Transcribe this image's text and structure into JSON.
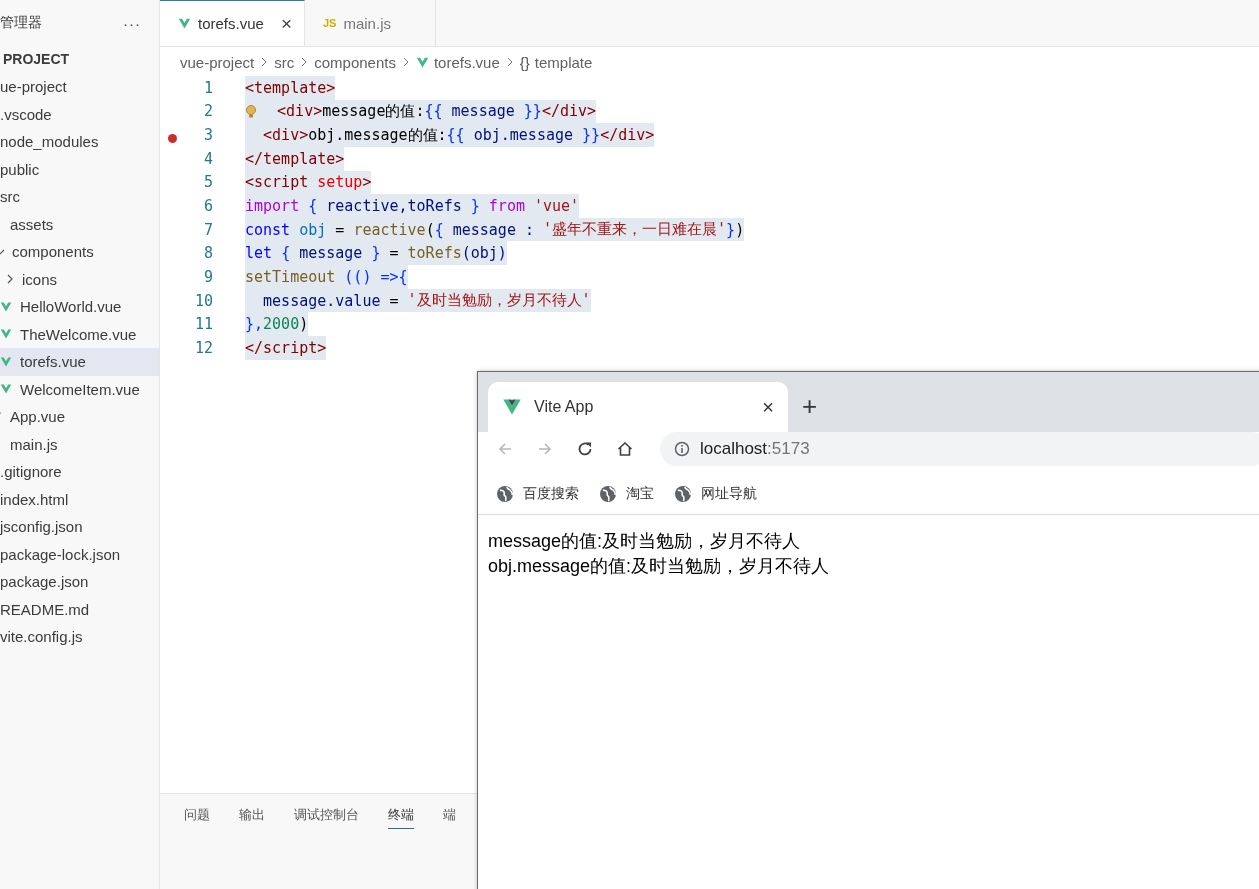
{
  "sidebar": {
    "title": "管理器",
    "more": "···",
    "section": "PROJECT",
    "root": "ue-project",
    "tree": [
      {
        "label": ".vscode",
        "selected": false
      },
      {
        "label": "node_modules",
        "selected": false
      },
      {
        "label": "public",
        "selected": false
      },
      {
        "label": "src",
        "selected": false,
        "children": [
          {
            "label": "assets",
            "selected": false
          },
          {
            "label": "components",
            "expanded": true,
            "selected": false,
            "children": [
              {
                "label": "icons",
                "expanded": false,
                "selected": false
              },
              {
                "label": "HelloWorld.vue",
                "kind": "vue",
                "selected": false
              },
              {
                "label": "TheWelcome.vue",
                "kind": "vue",
                "selected": false
              },
              {
                "label": "torefs.vue",
                "kind": "vue",
                "selected": true
              },
              {
                "label": "WelcomeItem.vue",
                "kind": "vue",
                "selected": false
              }
            ]
          },
          {
            "label": "App.vue",
            "kind": "vue",
            "selected": false
          },
          {
            "label": "main.js",
            "selected": false
          }
        ]
      },
      {
        "label": ".gitignore",
        "selected": false
      },
      {
        "label": "index.html",
        "selected": false
      },
      {
        "label": "jsconfig.json",
        "selected": false
      },
      {
        "label": "package-lock.json",
        "selected": false
      },
      {
        "label": "package.json",
        "selected": false
      },
      {
        "label": "README.md",
        "selected": false
      },
      {
        "label": "vite.config.js",
        "selected": false
      }
    ]
  },
  "tabs": [
    {
      "label": "torefs.vue",
      "kind": "vue",
      "selected": true,
      "close": "×"
    },
    {
      "label": "main.js",
      "kind": "js",
      "badge": "JS",
      "selected": false
    }
  ],
  "breadcrumb": [
    {
      "label": "vue-project"
    },
    {
      "label": "src"
    },
    {
      "label": "components"
    },
    {
      "label": "torefs.vue",
      "kind": "vue"
    },
    {
      "label": "template",
      "kind": "symbol",
      "badge": "{}"
    }
  ],
  "code": [
    {
      "number": "1",
      "selected": true,
      "tokens": [
        {
          "text": "<template>",
          "kind": "tag"
        }
      ]
    },
    {
      "number": "2",
      "selected": true,
      "lightbulb": true,
      "tokens": [
        {
          "text": "  <div>",
          "kind": "tag"
        },
        {
          "text": "message的值:",
          "kind": "plain"
        },
        {
          "text": "{{",
          "kind": "brace"
        },
        {
          "text": " message ",
          "kind": "prop"
        },
        {
          "text": "}}",
          "kind": "brace"
        },
        {
          "text": "</div>",
          "kind": "tag"
        }
      ]
    },
    {
      "number": "3",
      "selected": true,
      "breakpoint": true,
      "tokens": [
        {
          "text": "  <div>",
          "kind": "tag"
        },
        {
          "text": "obj.message的值:",
          "kind": "plain"
        },
        {
          "text": "{{",
          "kind": "brace"
        },
        {
          "text": " obj.message ",
          "kind": "prop"
        },
        {
          "text": "}}",
          "kind": "brace"
        },
        {
          "text": "</div>",
          "kind": "tag"
        }
      ]
    },
    {
      "number": "4",
      "selected": true,
      "tokens": [
        {
          "text": "</template>",
          "kind": "tag"
        }
      ]
    },
    {
      "number": "5",
      "selected": true,
      "tokens": [
        {
          "text": "<script ",
          "kind": "tag"
        },
        {
          "text": "setup",
          "kind": "attr"
        },
        {
          "text": ">",
          "kind": "tag"
        }
      ]
    },
    {
      "number": "6",
      "selected": true,
      "tokens": [
        {
          "text": "import ",
          "kind": "ctl"
        },
        {
          "text": "{",
          "kind": "brace"
        },
        {
          "text": " reactive,toRefs ",
          "kind": "prop"
        },
        {
          "text": "} ",
          "kind": "brace"
        },
        {
          "text": "from ",
          "kind": "ctl"
        },
        {
          "text": "'vue'",
          "kind": "str"
        }
      ]
    },
    {
      "number": "7",
      "selected": true,
      "tokens": [
        {
          "text": "const ",
          "kind": "kw"
        },
        {
          "text": "obj",
          "kind": "var"
        },
        {
          "text": " = ",
          "kind": "plain"
        },
        {
          "text": "reactive",
          "kind": "func"
        },
        {
          "text": "(",
          "kind": "plain"
        },
        {
          "text": "{",
          "kind": "brace"
        },
        {
          "text": " message : ",
          "kind": "prop"
        },
        {
          "text": "'盛年不重来，一日难在晨'",
          "kind": "str"
        },
        {
          "text": "}",
          "kind": "brace"
        },
        {
          "text": ")",
          "kind": "plain"
        }
      ]
    },
    {
      "number": "8",
      "selected": true,
      "tokens": [
        {
          "text": "let ",
          "kind": "kw"
        },
        {
          "text": "{",
          "kind": "brace"
        },
        {
          "text": " message ",
          "kind": "prop"
        },
        {
          "text": "}",
          "kind": "brace"
        },
        {
          "text": " = ",
          "kind": "plain"
        },
        {
          "text": "toRefs",
          "kind": "func"
        },
        {
          "text": "(obj)",
          "kind": "prop"
        }
      ]
    },
    {
      "number": "9",
      "selected": true,
      "tokens": [
        {
          "text": "setTimeout ",
          "kind": "func"
        },
        {
          "text": "(() =>{",
          "kind": "brace"
        }
      ]
    },
    {
      "number": "10",
      "selected": true,
      "tokens": [
        {
          "text": "  message.value",
          "kind": "prop"
        },
        {
          "text": " = ",
          "kind": "plain"
        },
        {
          "text": "'及时当勉励，岁月不待人'",
          "kind": "str"
        }
      ]
    },
    {
      "number": "11",
      "selected": true,
      "tokens": [
        {
          "text": "},",
          "kind": "brace"
        },
        {
          "text": "2000",
          "kind": "num"
        },
        {
          "text": ")",
          "kind": "plain"
        }
      ]
    },
    {
      "number": "12",
      "selected": true,
      "tokens": [
        {
          "text": "</script>",
          "kind": "tag"
        }
      ]
    }
  ],
  "panel": {
    "tabs": [
      {
        "label": "问题",
        "selected": false
      },
      {
        "label": "输出",
        "selected": false
      },
      {
        "label": "调试控制台",
        "selected": false
      },
      {
        "label": "终端",
        "selected": true
      },
      {
        "label": "端",
        "selected": false
      }
    ]
  },
  "browser": {
    "tab": {
      "title": "Vite App",
      "close": "×"
    },
    "new_tab": "+",
    "nav": [
      {
        "kind": "back",
        "disabled": true
      },
      {
        "kind": "forward",
        "disabled": true
      },
      {
        "kind": "reload",
        "disabled": false
      },
      {
        "kind": "home",
        "disabled": false
      }
    ],
    "address": {
      "host": "localhost",
      "port": ":5173"
    },
    "bookmarks": [
      "百度搜索",
      "淘宝",
      "网址导航"
    ],
    "content": [
      "message的值:及时当勉励，岁月不待人",
      "obj.message的值:及时当勉励，岁月不待人"
    ]
  }
}
